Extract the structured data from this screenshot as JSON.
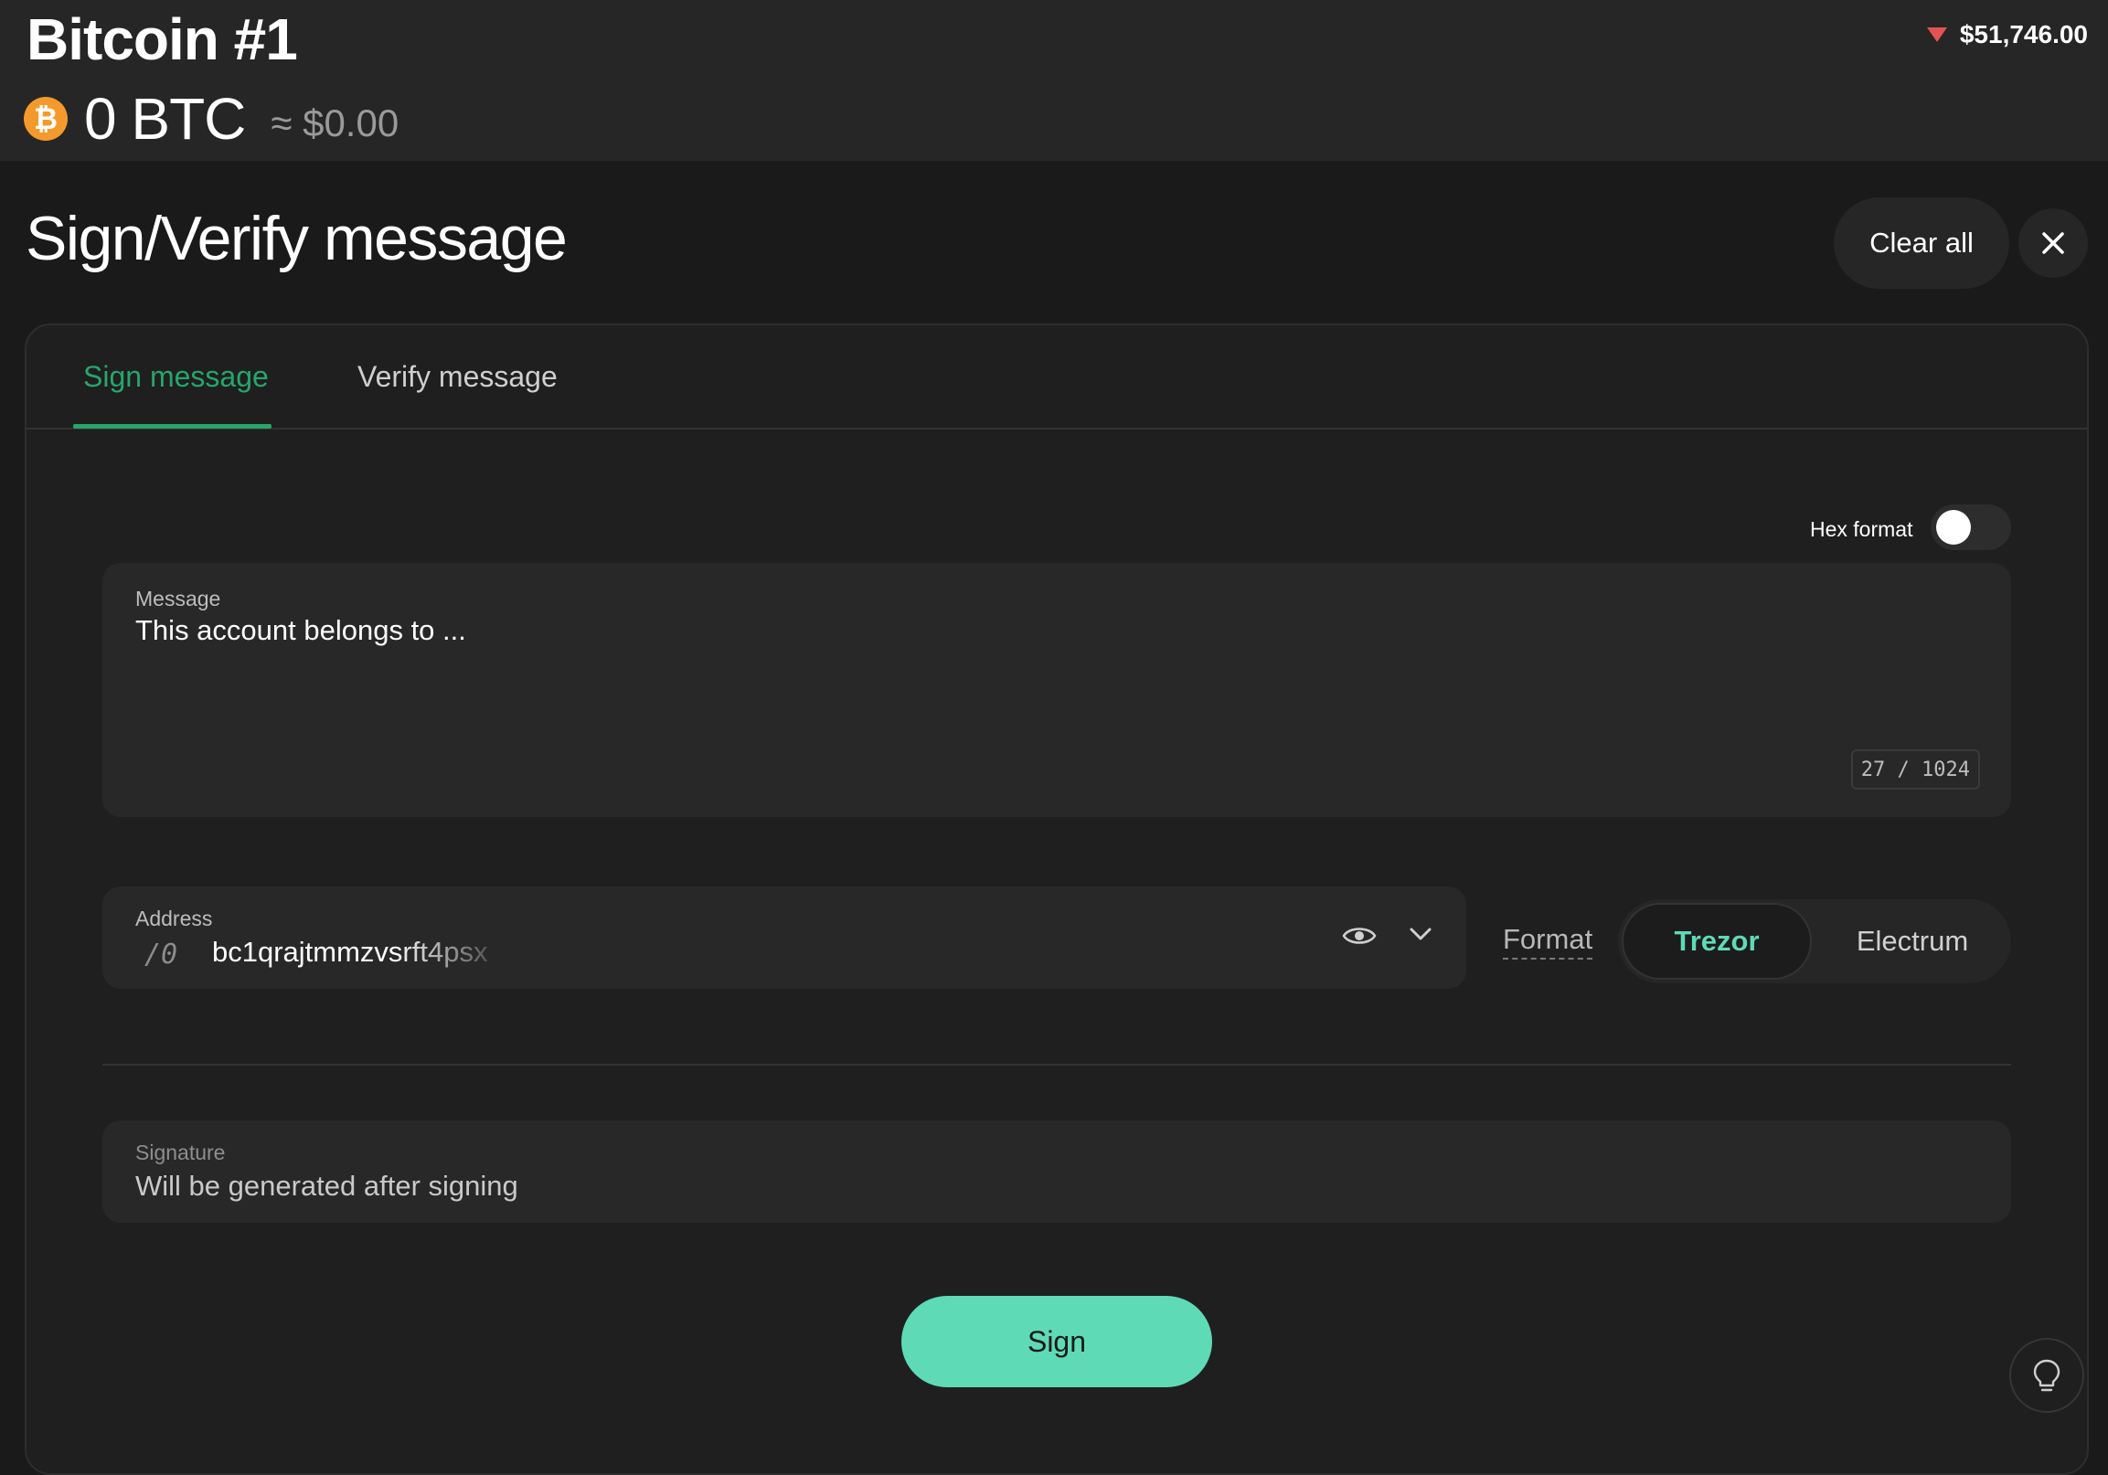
{
  "header": {
    "account_name": "Bitcoin #1",
    "coin_icon": "bitcoin-icon",
    "coin_symbol": "₿",
    "balance_crypto": "0 BTC",
    "balance_fiat": "≈ $0.00",
    "rate": "$51,746.00",
    "rate_trend": "down"
  },
  "page": {
    "title": "Sign/Verify message",
    "clear_all_label": "Clear all",
    "close_icon": "close-icon"
  },
  "tabs": [
    {
      "label": "Sign message",
      "active": true
    },
    {
      "label": "Verify message",
      "active": false
    }
  ],
  "form": {
    "hex_label": "Hex format",
    "hex_enabled": false,
    "message": {
      "label": "Message",
      "value": "This account belongs to ...",
      "counter": "27 / 1024"
    },
    "address": {
      "label": "Address",
      "path": "/0",
      "value": "bc1qrajtmmzvsrft4psx"
    },
    "format": {
      "label": "Format",
      "options": [
        "Trezor",
        "Electrum"
      ],
      "selected": "Trezor"
    },
    "signature": {
      "label": "Signature",
      "placeholder": "Will be generated after signing"
    },
    "sign_label": "Sign"
  },
  "colors": {
    "accent": "#27a56b",
    "button": "#5fdab6",
    "rate_down": "#e25353",
    "coin": "#f49a2d"
  }
}
